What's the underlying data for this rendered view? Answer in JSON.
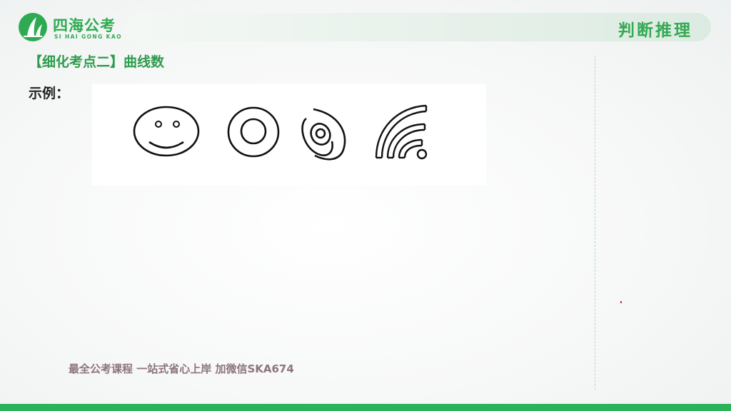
{
  "brand": {
    "name_cn": "四海公考",
    "name_en": "SI HAI GONG KAO",
    "logo_icon": "sail-leaf-icon",
    "color": "#2eab52"
  },
  "header": {
    "section_title": "判断推理"
  },
  "content": {
    "topic": "【细化考点二】曲线数",
    "example_label": "示例：",
    "figures": [
      "smiley-face-icon",
      "concentric-circles-icon",
      "spiral-ellipses-icon",
      "quarter-arcs-icon"
    ]
  },
  "footer": {
    "watermark": "最全公考课程 一站式省心上岸 加微信SKA674",
    "bar_color": "#2bb35a"
  }
}
